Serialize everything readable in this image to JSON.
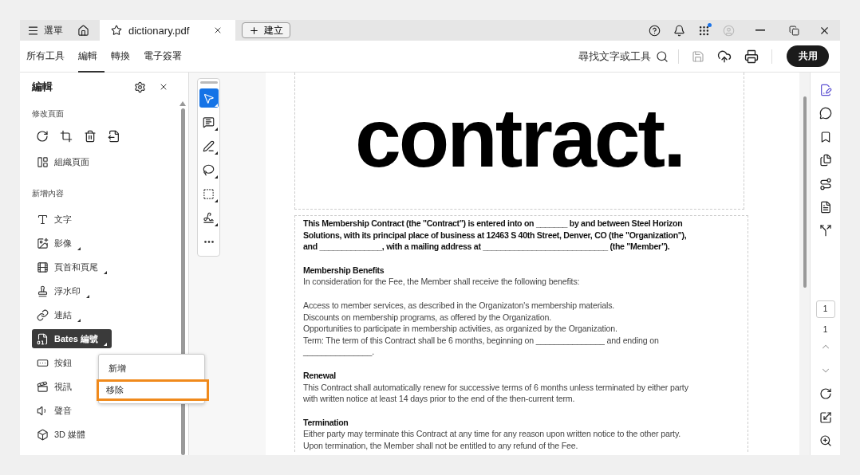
{
  "title_bar": {
    "menu_label": "選單",
    "tab": {
      "title": "dictionary.pdf"
    },
    "create_label": "建立"
  },
  "toolbar": {
    "tabs": [
      {
        "label": "所有工具",
        "selected": false
      },
      {
        "label": "編輯",
        "selected": true
      },
      {
        "label": "轉換",
        "selected": false
      },
      {
        "label": "電子簽署",
        "selected": false
      }
    ],
    "search_label": "尋找文字或工具",
    "save_disabled": true,
    "share_label": "共用"
  },
  "edit_panel": {
    "title": "編輯",
    "modify_heading": "修改頁面",
    "organize_label": "組織頁面",
    "add_heading": "新增內容",
    "items": [
      {
        "label": "文字",
        "has_menu": false,
        "selected": false
      },
      {
        "label": "影像",
        "has_menu": true,
        "selected": false
      },
      {
        "label": "頁首和頁尾",
        "has_menu": true,
        "selected": false
      },
      {
        "label": "浮水印",
        "has_menu": true,
        "selected": false
      },
      {
        "label": "連結",
        "has_menu": true,
        "selected": false
      },
      {
        "label": "Bates 編號",
        "has_menu": true,
        "selected": true
      },
      {
        "label": "按鈕",
        "has_menu": false,
        "selected": false
      },
      {
        "label": "視訊",
        "has_menu": false,
        "selected": false
      },
      {
        "label": "聲音",
        "has_menu": false,
        "selected": false
      },
      {
        "label": "3D 媒體",
        "has_menu": false,
        "selected": false
      }
    ]
  },
  "context_menu": [
    {
      "label": "新增",
      "selected": false
    },
    {
      "label": "移除",
      "selected": true
    }
  ],
  "tools": [
    {
      "has_menu": true,
      "selected": true
    },
    {
      "has_menu": true,
      "selected": false
    },
    {
      "has_menu": true,
      "selected": false
    },
    {
      "has_menu": true,
      "selected": false
    },
    {
      "has_menu": true,
      "selected": false
    },
    {
      "has_menu": true,
      "selected": false
    },
    {
      "has_menu": false,
      "selected": false
    }
  ],
  "document": {
    "logo": "contract.",
    "intro": [
      "This Membership Contract (the \"Contract\") is entered into on _______ by and between Steel Horizon",
      "Solutions, with its principal place of business at 12463 S 40th Street, Denver, CO (the \"Organization\"),",
      "and ______________, with a mailing address at ____________________________ (the \"Member\")."
    ],
    "sections": [
      {
        "heading": "Membership Benefits",
        "paragraphs": [
          [
            "In consideration for the Fee, the Member shall receive the following benefits:"
          ],
          [
            "Access to member services, as described in the Organizaton's membership materials.",
            "Discounts on membership programs, as offered by the Organization.",
            "Opportunities to participate in membership activities, as organized by the Organization.",
            "Term: The term of this Contract shall be 6 months, beginning on _______________ and ending on",
            "_______________."
          ]
        ]
      },
      {
        "heading": "Renewal",
        "paragraphs": [
          [
            "This Contract shall automatically renew for successive terms of 6 months unless terminated by either party",
            "with written notice at least 14 days prior to the end of the then-current term."
          ]
        ]
      },
      {
        "heading": "Termination",
        "paragraphs": [
          [
            "Either party may terminate this Contract at any time for any reason upon written notice to the other party.",
            "Upon termination, the Member shall not be entitled to any refund of the Fee."
          ]
        ]
      }
    ]
  },
  "page_nav": {
    "current": "1",
    "total": "1"
  }
}
